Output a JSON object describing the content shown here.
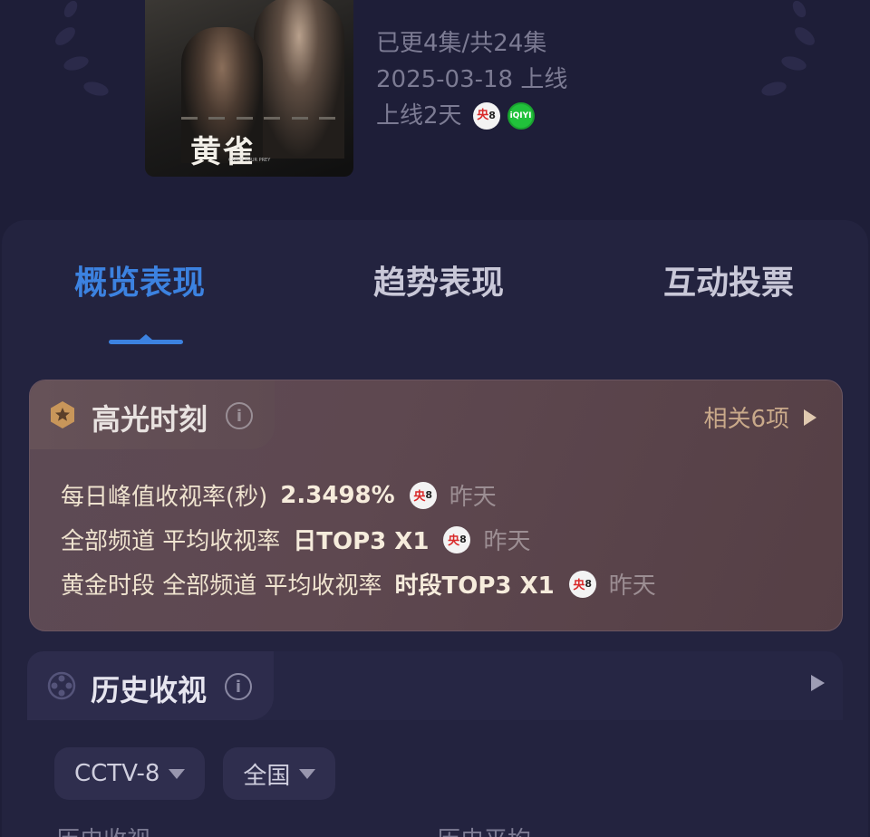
{
  "show": {
    "poster_title": "黄雀",
    "poster_subtitle": "CATCH YOUR PREY",
    "episodes": "已更4集/共24集",
    "release": "2025-03-18 上线",
    "days_online": "上线2天"
  },
  "platforms": {
    "cctv_label": "央",
    "cctv_num": "8",
    "iqiyi_label": "iQIYI"
  },
  "tabs": [
    {
      "label": "概览表现",
      "active": true
    },
    {
      "label": "趋势表现",
      "active": false
    },
    {
      "label": "互动投票",
      "active": false
    }
  ],
  "highlight": {
    "title": "高光时刻",
    "info": "i",
    "more_label": "相关6项",
    "lines": [
      {
        "label": "每日峰值收视率(秒)",
        "value": "2.3498%",
        "when": "昨天"
      },
      {
        "label": "全部频道 平均收视率",
        "value": "日TOP3 X1",
        "when": "昨天"
      },
      {
        "label": "黄金时段 全部频道 平均收视率",
        "value": "时段TOP3 X1",
        "when": "昨天"
      }
    ]
  },
  "history": {
    "title": "历史收视",
    "info": "i",
    "channel_select": "CCTV-8",
    "region_select": "全国",
    "label_left": "历史收视",
    "label_right": "历史平均"
  },
  "colors": {
    "background": "#1e1e38",
    "accent_blue": "#3c82e0",
    "highlight_card": "#5e4850",
    "muted_text": "#7c7b93"
  }
}
